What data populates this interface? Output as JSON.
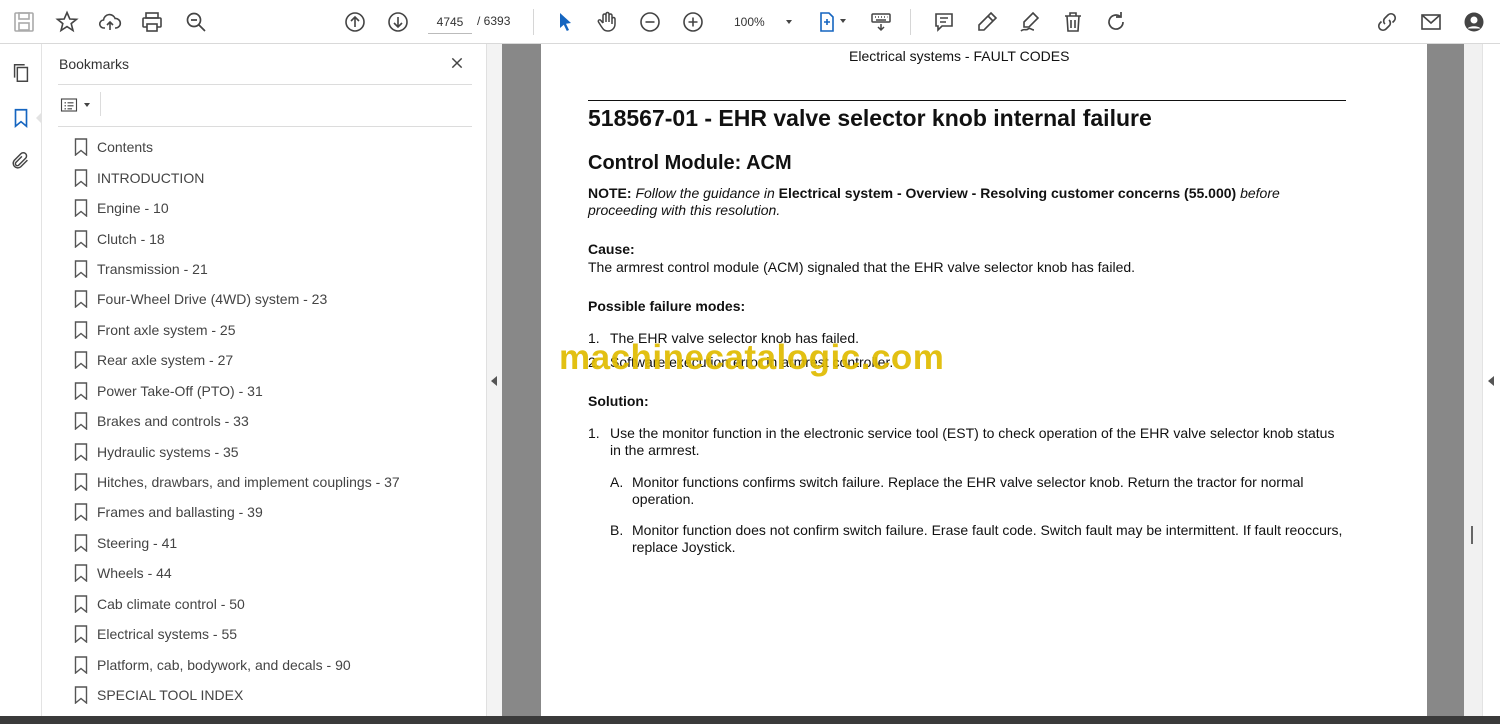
{
  "toolbar": {
    "current_page": "4745",
    "total_pages": "/ 6393",
    "zoom": "100%",
    "icons": [
      "save-icon",
      "star-icon",
      "cloud-upload-icon",
      "print-icon",
      "zoom-search-icon",
      "page-up-icon",
      "page-down-icon",
      "select-arrow-icon",
      "hand-icon",
      "zoom-out-icon",
      "zoom-in-icon",
      "fit-page-icon",
      "keyboard-icon",
      "comment-icon",
      "pen-icon",
      "sign-icon",
      "trash-icon",
      "rotate-icon",
      "share-link-icon",
      "mail-icon",
      "account-icon"
    ]
  },
  "rail": {
    "icons": [
      "pages-icon",
      "bookmark-icon",
      "attachment-icon"
    ]
  },
  "bookmarks": {
    "title": "Bookmarks",
    "items": [
      "Contents",
      "INTRODUCTION",
      "Engine - 10",
      "Clutch - 18",
      "Transmission - 21",
      "Four-Wheel Drive (4WD) system - 23",
      "Front axle system - 25",
      "Rear axle system - 27",
      "Power Take-Off (PTO) - 31",
      "Brakes and controls - 33",
      "Hydraulic systems - 35",
      "Hitches, drawbars, and implement couplings - 37",
      "Frames and ballasting - 39",
      "Steering - 41",
      "Wheels - 44",
      "Cab climate control - 50",
      "Electrical systems - 55",
      "Platform, cab, bodywork, and decals - 90",
      "SPECIAL TOOL INDEX"
    ]
  },
  "document": {
    "running_head": "Electrical systems - FAULT CODES",
    "title": "518567-01 - EHR valve selector knob internal failure",
    "module": "Control Module:  ACM",
    "note_label": "NOTE:",
    "note_pre": " Follow the guidance in ",
    "note_bold": "Electrical system - Overview - Resolving customer concerns (55.000)",
    "note_post": " before proceeding with this resolution.",
    "cause_heading": "Cause:",
    "cause_text": "The armrest control module (ACM) signaled that the EHR valve selector knob has failed.",
    "failure_heading": "Possible failure modes:",
    "failure_modes": [
      {
        "num": "1.",
        "text": "The EHR valve selector knob has failed."
      },
      {
        "num": "2.",
        "text": "Software execution error in armrest controller."
      }
    ],
    "solution_heading": "Solution:",
    "solution_steps": [
      {
        "num": "1.",
        "text": "Use the monitor function in the electronic service tool (EST) to check operation of the EHR valve selector knob status in the armrest."
      }
    ],
    "solution_substeps": [
      {
        "num": "A.",
        "text": "Monitor functions confirms switch failure. Replace the EHR valve selector knob. Return the tractor for normal operation."
      },
      {
        "num": "B.",
        "text": "Monitor function does not confirm switch failure.  Erase fault code.  Switch fault may be intermittent.  If fault reoccurs, replace Joystick."
      }
    ],
    "watermark": "machinecatalogic.com"
  },
  "colors": {
    "watermark": "#e0bb00",
    "select_tool": "#1565c0",
    "doc_background": "#888888"
  }
}
